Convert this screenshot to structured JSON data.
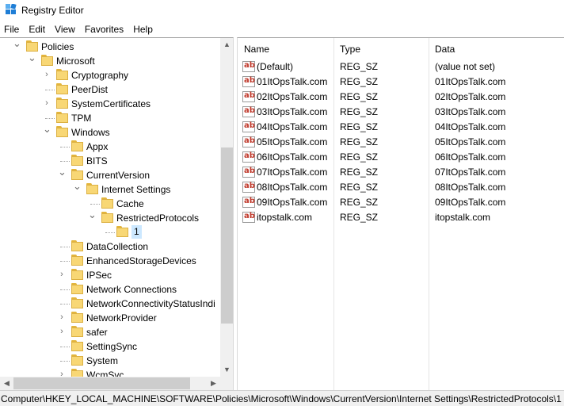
{
  "window": {
    "title": "Registry Editor",
    "icon": "registry-editor-icon"
  },
  "menu": [
    "File",
    "Edit",
    "View",
    "Favorites",
    "Help"
  ],
  "tree": [
    {
      "label": "Policies",
      "expander": "expanded"
    },
    {
      "label": "Microsoft",
      "expander": "expanded"
    },
    {
      "label": "Cryptography",
      "expander": "collapsed"
    },
    {
      "label": "PeerDist",
      "expander": "none"
    },
    {
      "label": "SystemCertificates",
      "expander": "collapsed"
    },
    {
      "label": "TPM",
      "expander": "none"
    },
    {
      "label": "Windows",
      "expander": "expanded"
    },
    {
      "label": "Appx",
      "expander": "none"
    },
    {
      "label": "BITS",
      "expander": "none"
    },
    {
      "label": "CurrentVersion",
      "expander": "expanded"
    },
    {
      "label": "Internet Settings",
      "expander": "expanded"
    },
    {
      "label": "Cache",
      "expander": "none"
    },
    {
      "label": "RestrictedProtocols",
      "expander": "expanded"
    },
    {
      "label": "1",
      "expander": "none",
      "selected": true
    },
    {
      "label": "DataCollection",
      "expander": "none"
    },
    {
      "label": "EnhancedStorageDevices",
      "expander": "none"
    },
    {
      "label": "IPSec",
      "expander": "collapsed"
    },
    {
      "label": "Network Connections",
      "expander": "none"
    },
    {
      "label": "NetworkConnectivityStatusIndi",
      "expander": "none"
    },
    {
      "label": "NetworkProvider",
      "expander": "collapsed"
    },
    {
      "label": "safer",
      "expander": "collapsed"
    },
    {
      "label": "SettingSync",
      "expander": "none"
    },
    {
      "label": "System",
      "expander": "none"
    },
    {
      "label": "WcmSvc",
      "expander": "collapsed"
    }
  ],
  "columns": [
    "Name",
    "Type",
    "Data"
  ],
  "values": [
    {
      "name": "(Default)",
      "type": "REG_SZ",
      "data": "(value not set)"
    },
    {
      "name": "01ItOpsTalk.com",
      "type": "REG_SZ",
      "data": "01ItOpsTalk.com"
    },
    {
      "name": "02ItOpsTalk.com",
      "type": "REG_SZ",
      "data": "02ItOpsTalk.com"
    },
    {
      "name": "03ItOpsTalk.com",
      "type": "REG_SZ",
      "data": "03ItOpsTalk.com"
    },
    {
      "name": "04ItOpsTalk.com",
      "type": "REG_SZ",
      "data": "04ItOpsTalk.com"
    },
    {
      "name": "05ItOpsTalk.com",
      "type": "REG_SZ",
      "data": "05ItOpsTalk.com"
    },
    {
      "name": "06ItOpsTalk.com",
      "type": "REG_SZ",
      "data": "06ItOpsTalk.com"
    },
    {
      "name": "07ItOpsTalk.com",
      "type": "REG_SZ",
      "data": "07ItOpsTalk.com"
    },
    {
      "name": "08ItOpsTalk.com",
      "type": "REG_SZ",
      "data": "08ItOpsTalk.com"
    },
    {
      "name": "09ItOpsTalk.com",
      "type": "REG_SZ",
      "data": "09ItOpsTalk.com"
    },
    {
      "name": "itopstalk.com",
      "type": "REG_SZ",
      "data": "itopstalk.com"
    }
  ],
  "value_icon_text": "ab",
  "status": "Computer\\HKEY_LOCAL_MACHINE\\SOFTWARE\\Policies\\Microsoft\\Windows\\CurrentVersion\\Internet Settings\\RestrictedProtocols\\1",
  "colors": {
    "folder": "#f8d775",
    "selection": "#cce8ff",
    "value_icon": "#c0392b"
  }
}
